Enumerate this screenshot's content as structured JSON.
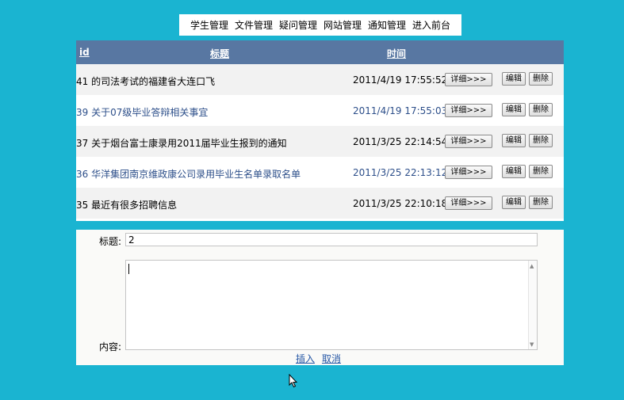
{
  "nav": {
    "items": [
      "学生管理",
      "文件管理",
      "疑问管理",
      "网站管理",
      "通知管理",
      "进入前台"
    ]
  },
  "table": {
    "headers": {
      "id": "id",
      "title": "标题",
      "time": "时间"
    },
    "rows": [
      {
        "title": "41 的司法考试的福建省大连口飞",
        "time": "2011/4/19 17:55:52"
      },
      {
        "title": "39 关于07级毕业答辩相关事宜",
        "time": "2011/4/19 17:55:03"
      },
      {
        "title": "37 关于烟台富士康录用2011届毕业生报到的通知",
        "time": "2011/3/25 22:14:54"
      },
      {
        "title": "36 华洋集团南京维政康公司录用毕业生名单录取名单",
        "time": "2011/3/25 22:13:12"
      },
      {
        "title": "35 最近有很多招聘信息",
        "time": "2011/3/25 22:10:18"
      }
    ],
    "detail_label": "详细>>>",
    "edit_label": "编辑",
    "delete_label": "删除"
  },
  "form": {
    "title_label": "标题:",
    "title_value": "2",
    "content_label": "内容:",
    "content_value": "",
    "insert_label": "插入",
    "cancel_label": "取消"
  },
  "colors": {
    "background": "#1ab4d1",
    "header_bg": "#5877a2",
    "link": "#2456a5"
  }
}
